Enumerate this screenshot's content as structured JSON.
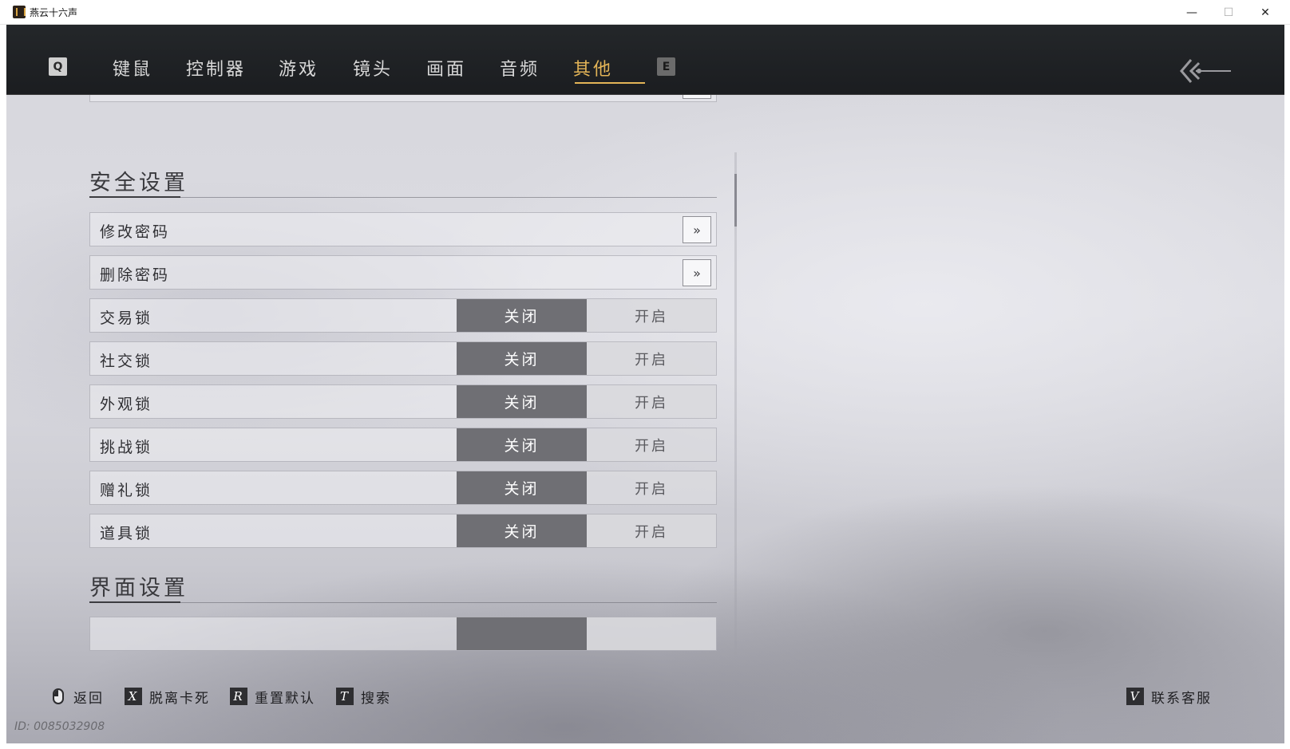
{
  "window": {
    "title": "燕云十六声",
    "minimize": "—",
    "maximize": "☐",
    "close": "✕"
  },
  "nav": {
    "prev_key": "Q",
    "next_key": "E",
    "tabs": [
      {
        "label": "键鼠"
      },
      {
        "label": "控制器"
      },
      {
        "label": "游戏"
      },
      {
        "label": "镜头"
      },
      {
        "label": "画面"
      },
      {
        "label": "音频"
      },
      {
        "label": "其他",
        "active": true
      }
    ],
    "active_color": "#e3b457"
  },
  "sections": {
    "security": {
      "title": "安全设置"
    },
    "interface": {
      "title": "界面设置"
    }
  },
  "security_rows": {
    "change_password": "修改密码",
    "delete_password": "删除密码",
    "arrow_glyph": "»"
  },
  "locks": [
    {
      "label": "交易锁",
      "off": "关闭",
      "on": "开启",
      "state": "off"
    },
    {
      "label": "社交锁",
      "off": "关闭",
      "on": "开启",
      "state": "off"
    },
    {
      "label": "外观锁",
      "off": "关闭",
      "on": "开启",
      "state": "off"
    },
    {
      "label": "挑战锁",
      "off": "关闭",
      "on": "开启",
      "state": "off"
    },
    {
      "label": "赠礼锁",
      "off": "关闭",
      "on": "开启",
      "state": "off"
    },
    {
      "label": "道具锁",
      "off": "关闭",
      "on": "开启",
      "state": "off"
    }
  ],
  "footer": {
    "back": "返回",
    "unstuck_key": "X",
    "unstuck": "脱离卡死",
    "reset_key": "R",
    "reset": "重置默认",
    "search_key": "T",
    "search": "搜索",
    "support_key": "V",
    "support": "联系客服",
    "player_id": "ID: 0085032908"
  }
}
